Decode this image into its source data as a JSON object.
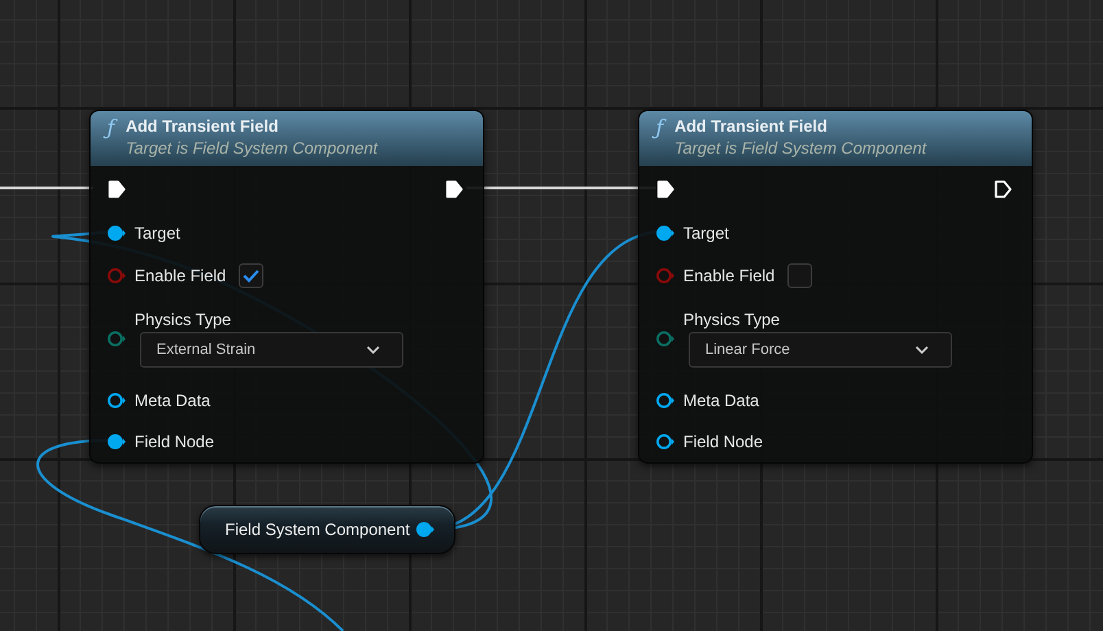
{
  "nodes": [
    {
      "icon": "ƒ",
      "title": "Add Transient Field",
      "subtitle": "Target is Field System Component",
      "exec_in_connected": true,
      "exec_out_connected": true,
      "pins": [
        {
          "kind": "object",
          "label": "Target",
          "color": "#00a8f0",
          "connected": true
        },
        {
          "kind": "bool",
          "label": "Enable Field",
          "color": "#8a0a0a",
          "connected": false,
          "checked": true
        },
        {
          "kind": "enum",
          "label": "Physics Type",
          "color": "#0b6e62",
          "connected": false,
          "value": "External Strain"
        },
        {
          "kind": "object",
          "label": "Meta Data",
          "color": "#00a8f0",
          "connected": false
        },
        {
          "kind": "object",
          "label": "Field Node",
          "color": "#00a8f0",
          "connected": true
        }
      ]
    },
    {
      "icon": "ƒ",
      "title": "Add Transient Field",
      "subtitle": "Target is Field System Component",
      "exec_in_connected": true,
      "exec_out_connected": false,
      "pins": [
        {
          "kind": "object",
          "label": "Target",
          "color": "#00a8f0",
          "connected": true
        },
        {
          "kind": "bool",
          "label": "Enable Field",
          "color": "#8a0a0a",
          "connected": false,
          "checked": false
        },
        {
          "kind": "enum",
          "label": "Physics Type",
          "color": "#0b6e62",
          "connected": false,
          "value": "Linear Force"
        },
        {
          "kind": "object",
          "label": "Meta Data",
          "color": "#00a8f0",
          "connected": false
        },
        {
          "kind": "object",
          "label": "Field Node",
          "color": "#00a8f0",
          "connected": false
        }
      ]
    }
  ],
  "variable": {
    "label": "Field System Component",
    "color": "#00a8f0",
    "connected": true
  }
}
